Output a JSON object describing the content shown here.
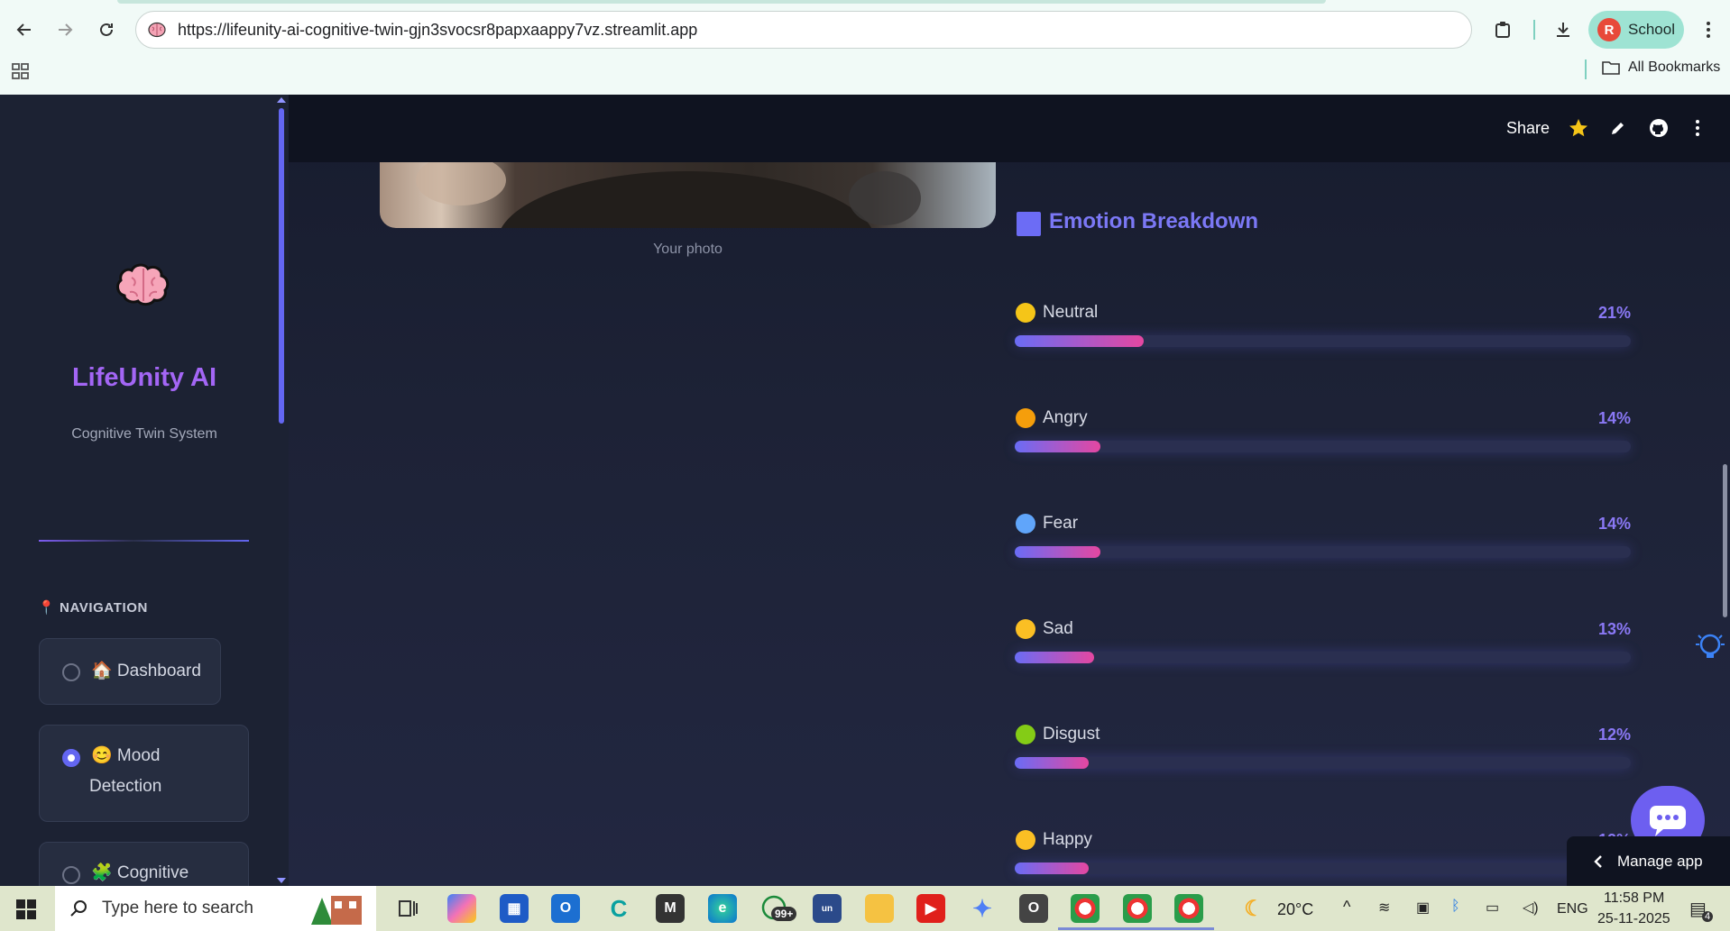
{
  "browser": {
    "url": "https://lifeunity-ai-cognitive-twin-gjn3svocsr8papxaappy7vz.streamlit.app",
    "profile_initial": "R",
    "profile_label": "School",
    "bookmarks_label": "All Bookmarks"
  },
  "header": {
    "share_label": "Share"
  },
  "sidebar": {
    "title": "LifeUnity AI",
    "subtitle": "Cognitive Twin System",
    "nav_heading": "📍 NAVIGATION",
    "items": [
      {
        "label": "🏠 Dashboard",
        "selected": false
      },
      {
        "label": "😊 Mood",
        "label_line2": "Detection",
        "selected": true
      },
      {
        "label": "🧩 Cognitive",
        "selected": false
      }
    ]
  },
  "main": {
    "photo_caption": "Your photo",
    "breakdown_title": "Emotion Breakdown",
    "emotions": [
      {
        "label": "Neutral",
        "percent_text": "21%",
        "value": 21
      },
      {
        "label": "Angry",
        "percent_text": "14%",
        "value": 14
      },
      {
        "label": "Fear",
        "percent_text": "14%",
        "value": 14
      },
      {
        "label": "Sad",
        "percent_text": "13%",
        "value": 13
      },
      {
        "label": "Disgust",
        "percent_text": "12%",
        "value": 12
      },
      {
        "label": "Happy",
        "percent_text": "12%",
        "value": 12
      }
    ],
    "manage_app_label": "Manage app"
  },
  "taskbar": {
    "search_placeholder": "Type here to search",
    "whatsapp_badge": "99+",
    "weather": "20°C",
    "language": "ENG",
    "time": "11:58 PM",
    "date": "25-11-2025",
    "notification_count": "4"
  },
  "colors": {
    "accent": "#6366f1",
    "title_purple": "#a366f5",
    "bar_gradient_start": "#6a6cf5",
    "bar_gradient_end": "#e447a1"
  }
}
